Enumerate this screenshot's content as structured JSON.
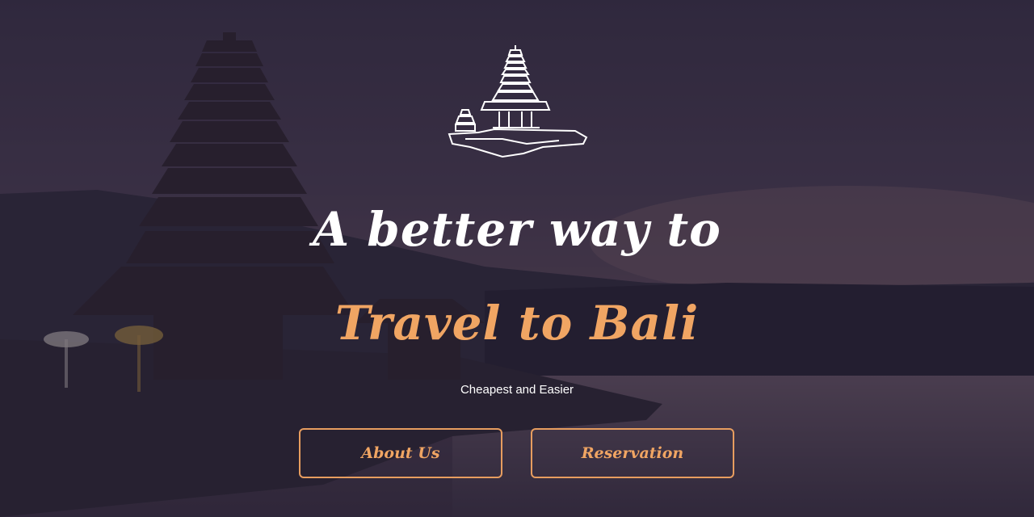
{
  "hero": {
    "headline_line1": "A better way to",
    "headline_line2": "Travel to Bali",
    "tagline": "Cheapest and Easier",
    "accent_color": "#f0a563",
    "logo_icon": "temple-logo-icon"
  },
  "buttons": {
    "about_label": "About Us",
    "reservation_label": "Reservation"
  }
}
